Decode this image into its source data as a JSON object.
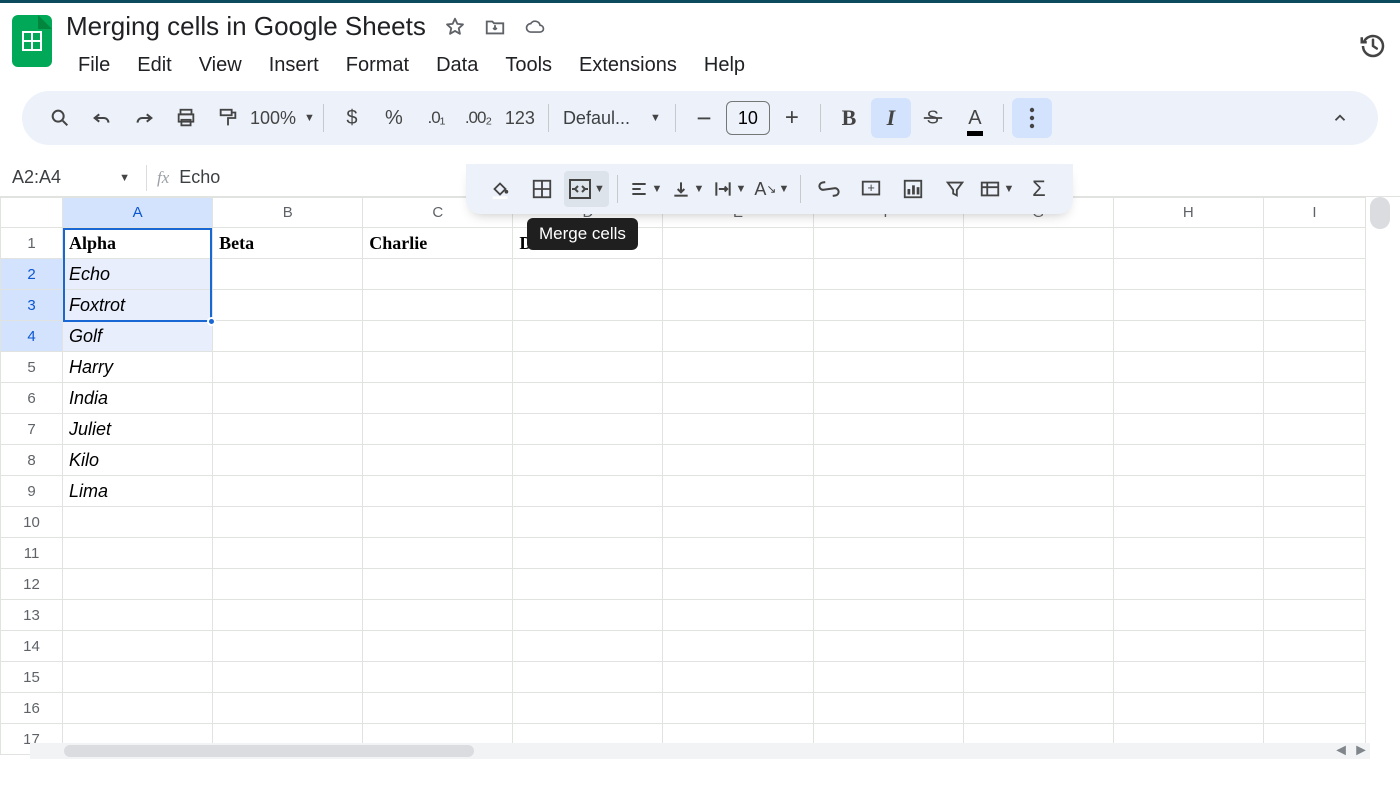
{
  "doc": {
    "title": "Merging cells in Google Sheets"
  },
  "menus": [
    "File",
    "Edit",
    "View",
    "Insert",
    "Format",
    "Data",
    "Tools",
    "Extensions",
    "Help"
  ],
  "toolbar": {
    "zoom": "100%",
    "font": "Defaul...",
    "font_size": "10",
    "num_fmt": "123"
  },
  "tooltip": "Merge cells",
  "name_box": "A2:A4",
  "fx_value": "Echo",
  "columns": [
    "A",
    "B",
    "C",
    "D",
    "E",
    "F",
    "G",
    "H",
    "I"
  ],
  "row_count": 17,
  "selected_rows": [
    2,
    3,
    4
  ],
  "selected_col": "A",
  "cells": {
    "A1": "Alpha",
    "B1": "Beta",
    "C1": "Charlie",
    "D1": "Delta",
    "A2": "Echo",
    "A3": "Foxtrot",
    "A4": "Golf",
    "A5": "Harry",
    "A6": "India",
    "A7": "Juliet",
    "A8": "Kilo",
    "A9": "Lima"
  },
  "bold_cells": [
    "A1",
    "B1",
    "C1",
    "D1"
  ],
  "italic_cells": [
    "A2",
    "A3",
    "A4",
    "A5",
    "A6",
    "A7",
    "A8",
    "A9"
  ]
}
